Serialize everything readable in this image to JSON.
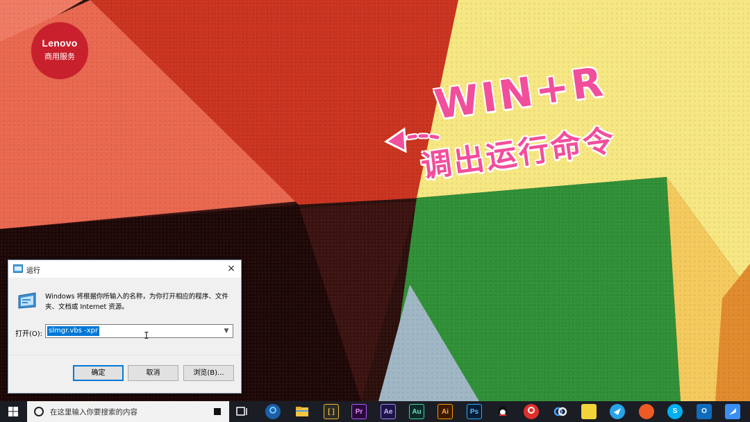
{
  "lenovo_badge": {
    "brand": "Lenovo",
    "sub": "商用服务"
  },
  "annotation": {
    "main": "WIN+R",
    "sub": "调出运行命令",
    "color": "#f14f9b"
  },
  "run_dialog": {
    "title": "运行",
    "close_glyph": "×",
    "description": "Windows 将根据你所输入的名称，为你打开相应的程序、文件夹、文档或 Internet 资源。",
    "open_label": "打开(O):",
    "open_value": "slmgr.vbs -xpr",
    "buttons": {
      "ok": "确定",
      "cancel": "取消",
      "browse": "浏览(B)..."
    }
  },
  "taskbar": {
    "search_placeholder": "在这里输入你要搜索的内容",
    "apps": [
      {
        "name": "task-view",
        "label": ""
      },
      {
        "name": "browser",
        "label": ""
      },
      {
        "name": "file-explorer",
        "label": ""
      },
      {
        "name": "editor",
        "label": "[ ]"
      },
      {
        "name": "premiere",
        "label": "Pr"
      },
      {
        "name": "after-effects",
        "label": "Ae"
      },
      {
        "name": "audition",
        "label": "Au"
      },
      {
        "name": "illustrator",
        "label": "Ai"
      },
      {
        "name": "photoshop",
        "label": "Ps"
      },
      {
        "name": "qq",
        "label": ""
      },
      {
        "name": "netease-music",
        "label": ""
      },
      {
        "name": "baidu-netdisk",
        "label": ""
      },
      {
        "name": "sticky-notes",
        "label": ""
      },
      {
        "name": "feishu",
        "label": ""
      },
      {
        "name": "weibo",
        "label": ""
      },
      {
        "name": "skype",
        "label": "S"
      },
      {
        "name": "outlook",
        "label": "O"
      },
      {
        "name": "lark",
        "label": ""
      }
    ]
  }
}
